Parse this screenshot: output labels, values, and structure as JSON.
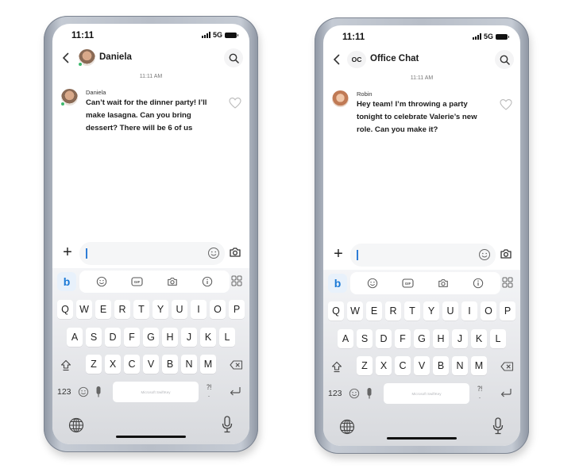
{
  "phones": [
    {
      "status": {
        "time": "11:11",
        "network": "5G"
      },
      "header": {
        "title": "Daniela",
        "avatar": "person-photo-avatar",
        "presence": "online"
      },
      "timestamp": "11:11 AM",
      "message": {
        "sender": "Daniela",
        "text": "Can’t wait for the dinner party! I’ll make lasagna. Can you bring dessert? There will be 6 of us"
      },
      "compose": {
        "value": "",
        "placeholder": ""
      }
    },
    {
      "status": {
        "time": "11:11",
        "network": "5G"
      },
      "header": {
        "title": "Office Chat",
        "initials": "OC"
      },
      "timestamp": "11:11 AM",
      "message": {
        "sender": "Robin",
        "text": "Hey team! I’m throwing a party tonight to celebrate Valerie’s new role. Can you make it?"
      },
      "compose": {
        "value": "",
        "placeholder": ""
      }
    }
  ],
  "keyboard": {
    "toolbar": [
      "bing-icon",
      "emoji-icon",
      "gif-icon",
      "camera-icon",
      "info-icon",
      "apps-grid-icon"
    ],
    "gif_label": "GIF",
    "bing_label": "b",
    "row1": [
      "Q",
      "W",
      "E",
      "R",
      "T",
      "Y",
      "U",
      "I",
      "O",
      "P"
    ],
    "row2": [
      "A",
      "S",
      "D",
      "F",
      "G",
      "H",
      "J",
      "K",
      "L"
    ],
    "row3": [
      "Z",
      "X",
      "C",
      "V",
      "B",
      "N",
      "M"
    ],
    "numbers_label": "123",
    "space_label": "Microsoft SwiftKey",
    "punct_label": "?!\n."
  },
  "colors": {
    "accent": "#2f7dd6",
    "bing": "#1b79d6",
    "presence": "#3fb96f",
    "frame": "#b8bec8"
  }
}
